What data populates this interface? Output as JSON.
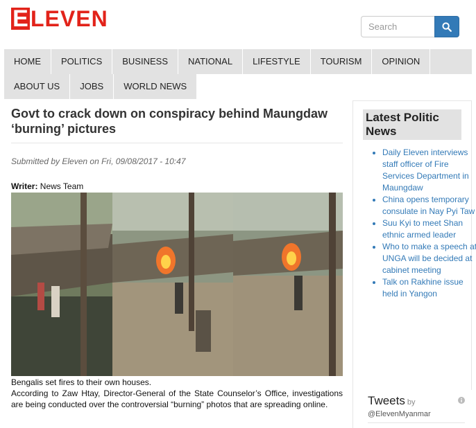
{
  "brand": {
    "logo_letter": "E",
    "logo_rest": "LEVEN",
    "accent": "#e2231a"
  },
  "search": {
    "placeholder": "Search",
    "icon": "search-icon"
  },
  "nav": {
    "row1": [
      "HOME",
      "POLITICS",
      "BUSINESS",
      "NATIONAL",
      "LIFESTYLE",
      "TOURISM",
      "OPINION"
    ],
    "row2": [
      "ABOUT US",
      "JOBS",
      "WORLD NEWS"
    ]
  },
  "article": {
    "title": "Govt to crack down on conspiracy behind Maungdaw ‘burning’ pictures",
    "submitted": "Submitted by Eleven on Fri, 09/08/2017 - 10:47",
    "writer_label": "Writer:",
    "writer": " News Team",
    "caption": "Bengalis set fires to their own houses.",
    "body": "According to Zaw Htay, Director-General of the State Counselor’s Office, investigations are being conducted over the controversial “burning” photos that are spreading online."
  },
  "sidebar": {
    "title": "Latest Politic News",
    "items": [
      "Daily Eleven interviews staff officer of Fire Services Department in Maungdaw",
      "China opens temporary consulate in Nay Pyi Taw",
      "Suu Kyi to meet Shan ethnic armed leader",
      "Who to make a speech at UNGA will be decided at cabinet meeting",
      "Talk on Rakhine issue held in Yangon"
    ]
  },
  "tweets": {
    "title": "Tweets",
    "by": "by",
    "handle": "@ElevenMyanmar",
    "icon": "info-icon"
  }
}
